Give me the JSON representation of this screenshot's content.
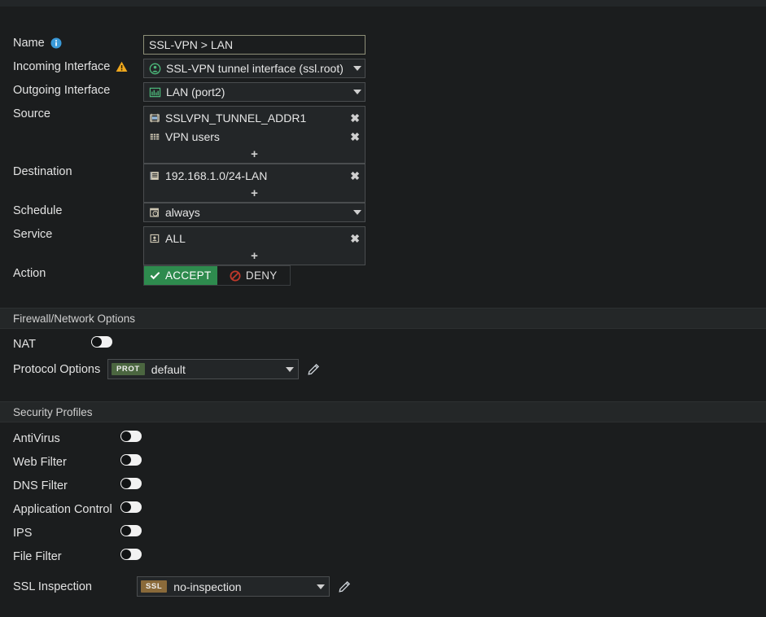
{
  "colors": {
    "page_bg": "#1b1d1e",
    "section_bg": "#242728",
    "accept_green": "#2e8b4e",
    "deny_red": "#c0392b",
    "prot_badge": "#4b6640",
    "ssl_badge": "#8a6a3a",
    "info_blue": "#3a9ad9",
    "warn_amber": "#f0a81e",
    "interface_green": "#4cb87a",
    "input_border": "#8e8f78"
  },
  "form": {
    "name": {
      "label": "Name",
      "info_icon": "info-circle-icon",
      "value": "SSL-VPN > LAN",
      "placeholder": ""
    },
    "incoming_interface": {
      "label": "Incoming Interface",
      "warning_icon": "warning-triangle-icon",
      "icon": "vpn-tunnel-icon",
      "value": "SSL-VPN tunnel interface (ssl.root)"
    },
    "outgoing_interface": {
      "label": "Outgoing Interface",
      "icon": "network-switch-icon",
      "value": "LAN (port2)"
    },
    "source": {
      "label": "Source",
      "items": [
        {
          "icon": "address-range-icon",
          "label": "SSLVPN_TUNNEL_ADDR1",
          "remove": "✖"
        },
        {
          "icon": "user-group-icon",
          "label": "VPN users",
          "remove": "✖"
        }
      ],
      "add": "+"
    },
    "destination": {
      "label": "Destination",
      "items": [
        {
          "icon": "subnet-icon",
          "label": "192.168.1.0/24-LAN",
          "remove": "✖"
        }
      ],
      "add": "+"
    },
    "schedule": {
      "label": "Schedule",
      "icon": "schedule-clock-icon",
      "value": "always"
    },
    "service": {
      "label": "Service",
      "items": [
        {
          "icon": "service-icon",
          "label": "ALL",
          "remove": "✖"
        }
      ],
      "add": "+"
    },
    "action": {
      "label": "Action",
      "accept_label": "ACCEPT",
      "deny_label": "DENY",
      "selected": "ACCEPT",
      "accept_icon": "check-icon",
      "deny_icon": "deny-circle-icon"
    }
  },
  "firewall_section": {
    "title": "Firewall/Network Options",
    "nat": {
      "label": "NAT",
      "state": "off"
    },
    "protocol_options": {
      "label": "Protocol Options",
      "badge": "PROT",
      "value": "default",
      "edit_icon": "pencil-edit-icon"
    }
  },
  "security_section": {
    "title": "Security Profiles",
    "toggles": [
      {
        "label": "AntiVirus",
        "state": "off"
      },
      {
        "label": "Web Filter",
        "state": "off"
      },
      {
        "label": "DNS Filter",
        "state": "off"
      },
      {
        "label": "Application Control",
        "state": "off"
      },
      {
        "label": "IPS",
        "state": "off"
      },
      {
        "label": "File Filter",
        "state": "off"
      }
    ],
    "ssl_inspection": {
      "label": "SSL Inspection",
      "badge": "SSL",
      "value": "no-inspection",
      "edit_icon": "pencil-edit-icon"
    }
  }
}
